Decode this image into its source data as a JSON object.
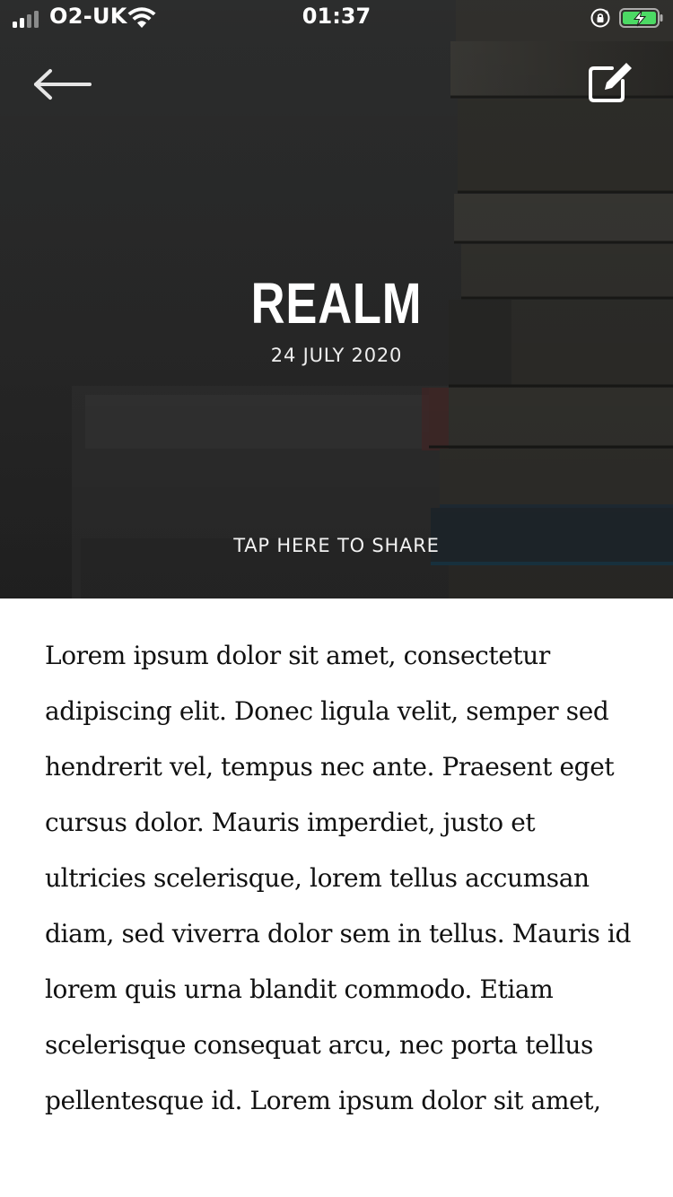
{
  "status_bar": {
    "carrier": "O2-UK",
    "time": "01:37",
    "battery_color": "#4cd964"
  },
  "nav": {
    "back_icon": "arrow-left-icon",
    "edit_icon": "edit-note-icon"
  },
  "article": {
    "title": "REALM",
    "date": "24 JULY 2020",
    "share_label": "TAP HERE TO SHARE",
    "body": "Lorem ipsum dolor sit amet, consectetur adipiscing elit. Donec ligula velit, semper sed hendrerit vel, tempus nec ante. Praesent eget cursus dolor. Mauris imperdiet, justo et ultricies scelerisque, lorem tellus accumsan diam, sed viverra dolor sem in tellus. Mauris id lorem quis urna blandit commodo. Etiam scelerisque consequat arcu, nec porta tellus pellentesque id. Lorem ipsum dolor sit amet,"
  }
}
